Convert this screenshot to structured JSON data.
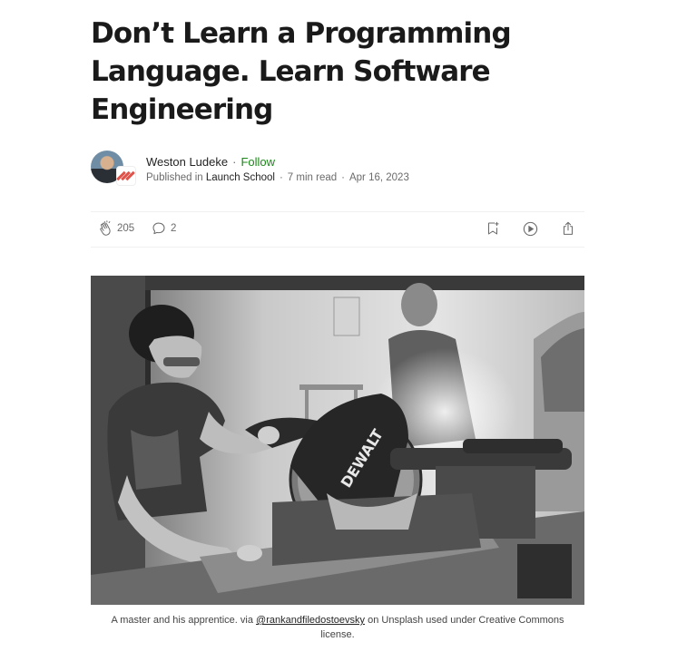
{
  "article": {
    "title": "Don’t Learn a Programming Language. Learn Software Engineering"
  },
  "author": {
    "name": "Weston Ludeke",
    "follow_label": "Follow",
    "published_in_label": "Published in",
    "publication": "Launch School",
    "read_time": "7 min read",
    "date": "Apr 16, 2023"
  },
  "actions": {
    "claps": "205",
    "responses": "2"
  },
  "caption": {
    "prefix": "A master and his apprentice. via ",
    "link": "@rankandfiledostoevsky",
    "suffix": " on Unsplash used under Creative Commons license."
  },
  "hero_image": {
    "style": "black-and-white photograph",
    "saw_brand_text": "DEWALT"
  },
  "colors": {
    "follow": "#1a8917",
    "text": "#242424",
    "muted": "#6b6b6b"
  },
  "icons": [
    "clap-icon",
    "comment-icon",
    "bookmark-add-icon",
    "play-listen-icon",
    "share-icon"
  ]
}
